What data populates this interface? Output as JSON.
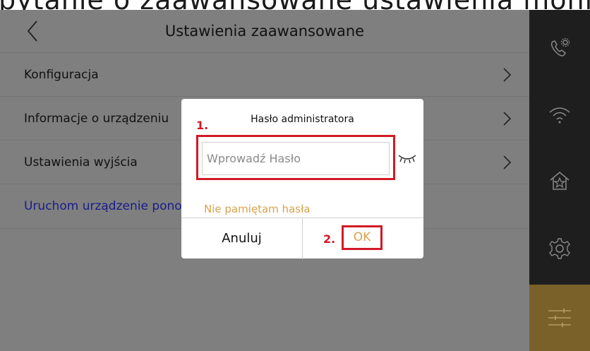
{
  "top_strip": {
    "text": "pytanie o zaawansowane ustawienia monitora i hasło administratora"
  },
  "header": {
    "title": "Ustawienia zaawansowane",
    "back_icon": "chevron-left-icon"
  },
  "menu": {
    "items": [
      {
        "label": "Konfiguracja",
        "icon": "chevron-right-icon"
      },
      {
        "label": "Informacje o urządzeniu",
        "icon": "chevron-right-icon"
      },
      {
        "label": "Ustawienia wyjścia",
        "icon": "chevron-right-icon"
      },
      {
        "label": "Uruchom urządzenie ponownie"
      }
    ]
  },
  "sidebar": {
    "items": [
      {
        "icon": "phone-settings-icon"
      },
      {
        "icon": "wifi-icon"
      },
      {
        "icon": "home-icon"
      },
      {
        "icon": "gear-icon"
      },
      {
        "icon": "sliders-icon",
        "active": true
      }
    ],
    "active_color": "#7a6129"
  },
  "dialog": {
    "title": "Hasło administratora",
    "step1": "1.",
    "password_placeholder": "Wprowadź Hasło",
    "eye_icon": "eye-closed-icon",
    "forgot_link": "Nie pamiętam hasła",
    "cancel_label": "Anuluj",
    "step2": "2.",
    "ok_label": "OK"
  },
  "colors": {
    "highlight": "#d11a26",
    "accent": "#d9a24d",
    "link": "#1a1c8a"
  }
}
